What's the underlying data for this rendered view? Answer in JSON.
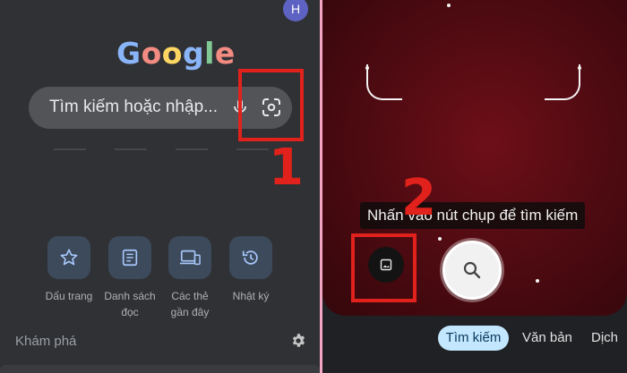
{
  "left": {
    "avatar_letter": "H",
    "logo_letters": [
      {
        "ch": "G",
        "color": "#8ab4f8"
      },
      {
        "ch": "o",
        "color": "#f28b82"
      },
      {
        "ch": "o",
        "color": "#fdd663"
      },
      {
        "ch": "g",
        "color": "#8ab4f8"
      },
      {
        "ch": "l",
        "color": "#81c995"
      },
      {
        "ch": "e",
        "color": "#f28b82"
      }
    ],
    "search_placeholder": "Tìm kiếm hoặc nhập...",
    "shortcuts": [
      {
        "label": "Dấu trang",
        "icon": "star-icon"
      },
      {
        "label": "Danh sách đọc",
        "icon": "reading-list-icon"
      },
      {
        "label": "Các thẻ gần đây",
        "icon": "devices-icon"
      },
      {
        "label": "Nhật ký",
        "icon": "history-icon"
      }
    ],
    "explore_label": "Khám phá",
    "annotation_number": "1"
  },
  "right": {
    "hint_text": "Nhấn vào nút chụp để tìm kiếm",
    "tabs": [
      "Tìm kiếm",
      "Văn bản",
      "Dịch"
    ],
    "active_tab": "Tìm kiếm",
    "annotation_number": "2"
  },
  "colors": {
    "annotation_red": "#e1211b",
    "active_tab_bg": "#c2e7ff",
    "camera_red": "#5a0c14"
  }
}
